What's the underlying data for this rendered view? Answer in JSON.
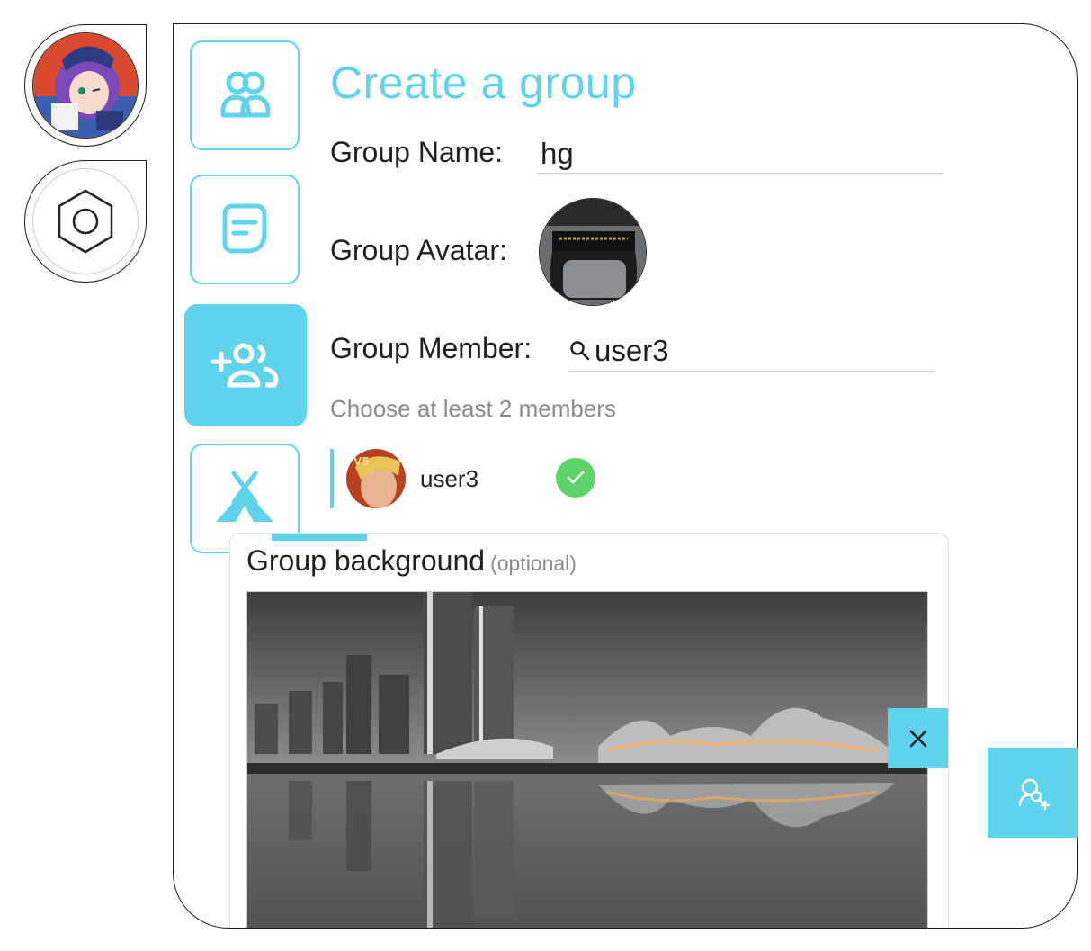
{
  "rail": {
    "profile_icon": "user-avatar-anime",
    "settings_icon": "hexagon-settings-icon"
  },
  "tabs": [
    {
      "icon": "people-icon",
      "active": false
    },
    {
      "icon": "chat-note-icon",
      "active": false
    },
    {
      "icon": "add-group-icon",
      "active": true
    },
    {
      "icon": "tent-icon",
      "active": false
    }
  ],
  "form": {
    "title": "Create a group",
    "group_name_label": "Group Name:",
    "group_name_value": "hg",
    "group_avatar_label": "Group Avatar:",
    "group_member_label": "Group Member:",
    "member_search_value": "user3",
    "hint": "Choose at least 2 members",
    "members": [
      {
        "name": "user3",
        "selected": true
      }
    ]
  },
  "background": {
    "title": "Group background",
    "optional": "(optional)"
  },
  "close_icon": "close-icon",
  "fab_icon": "find-user-add-icon",
  "colors": {
    "accent": "#5fd3ec",
    "check": "#5fd36a",
    "text": "#1f1f1f",
    "muted": "#8a8a8a"
  }
}
